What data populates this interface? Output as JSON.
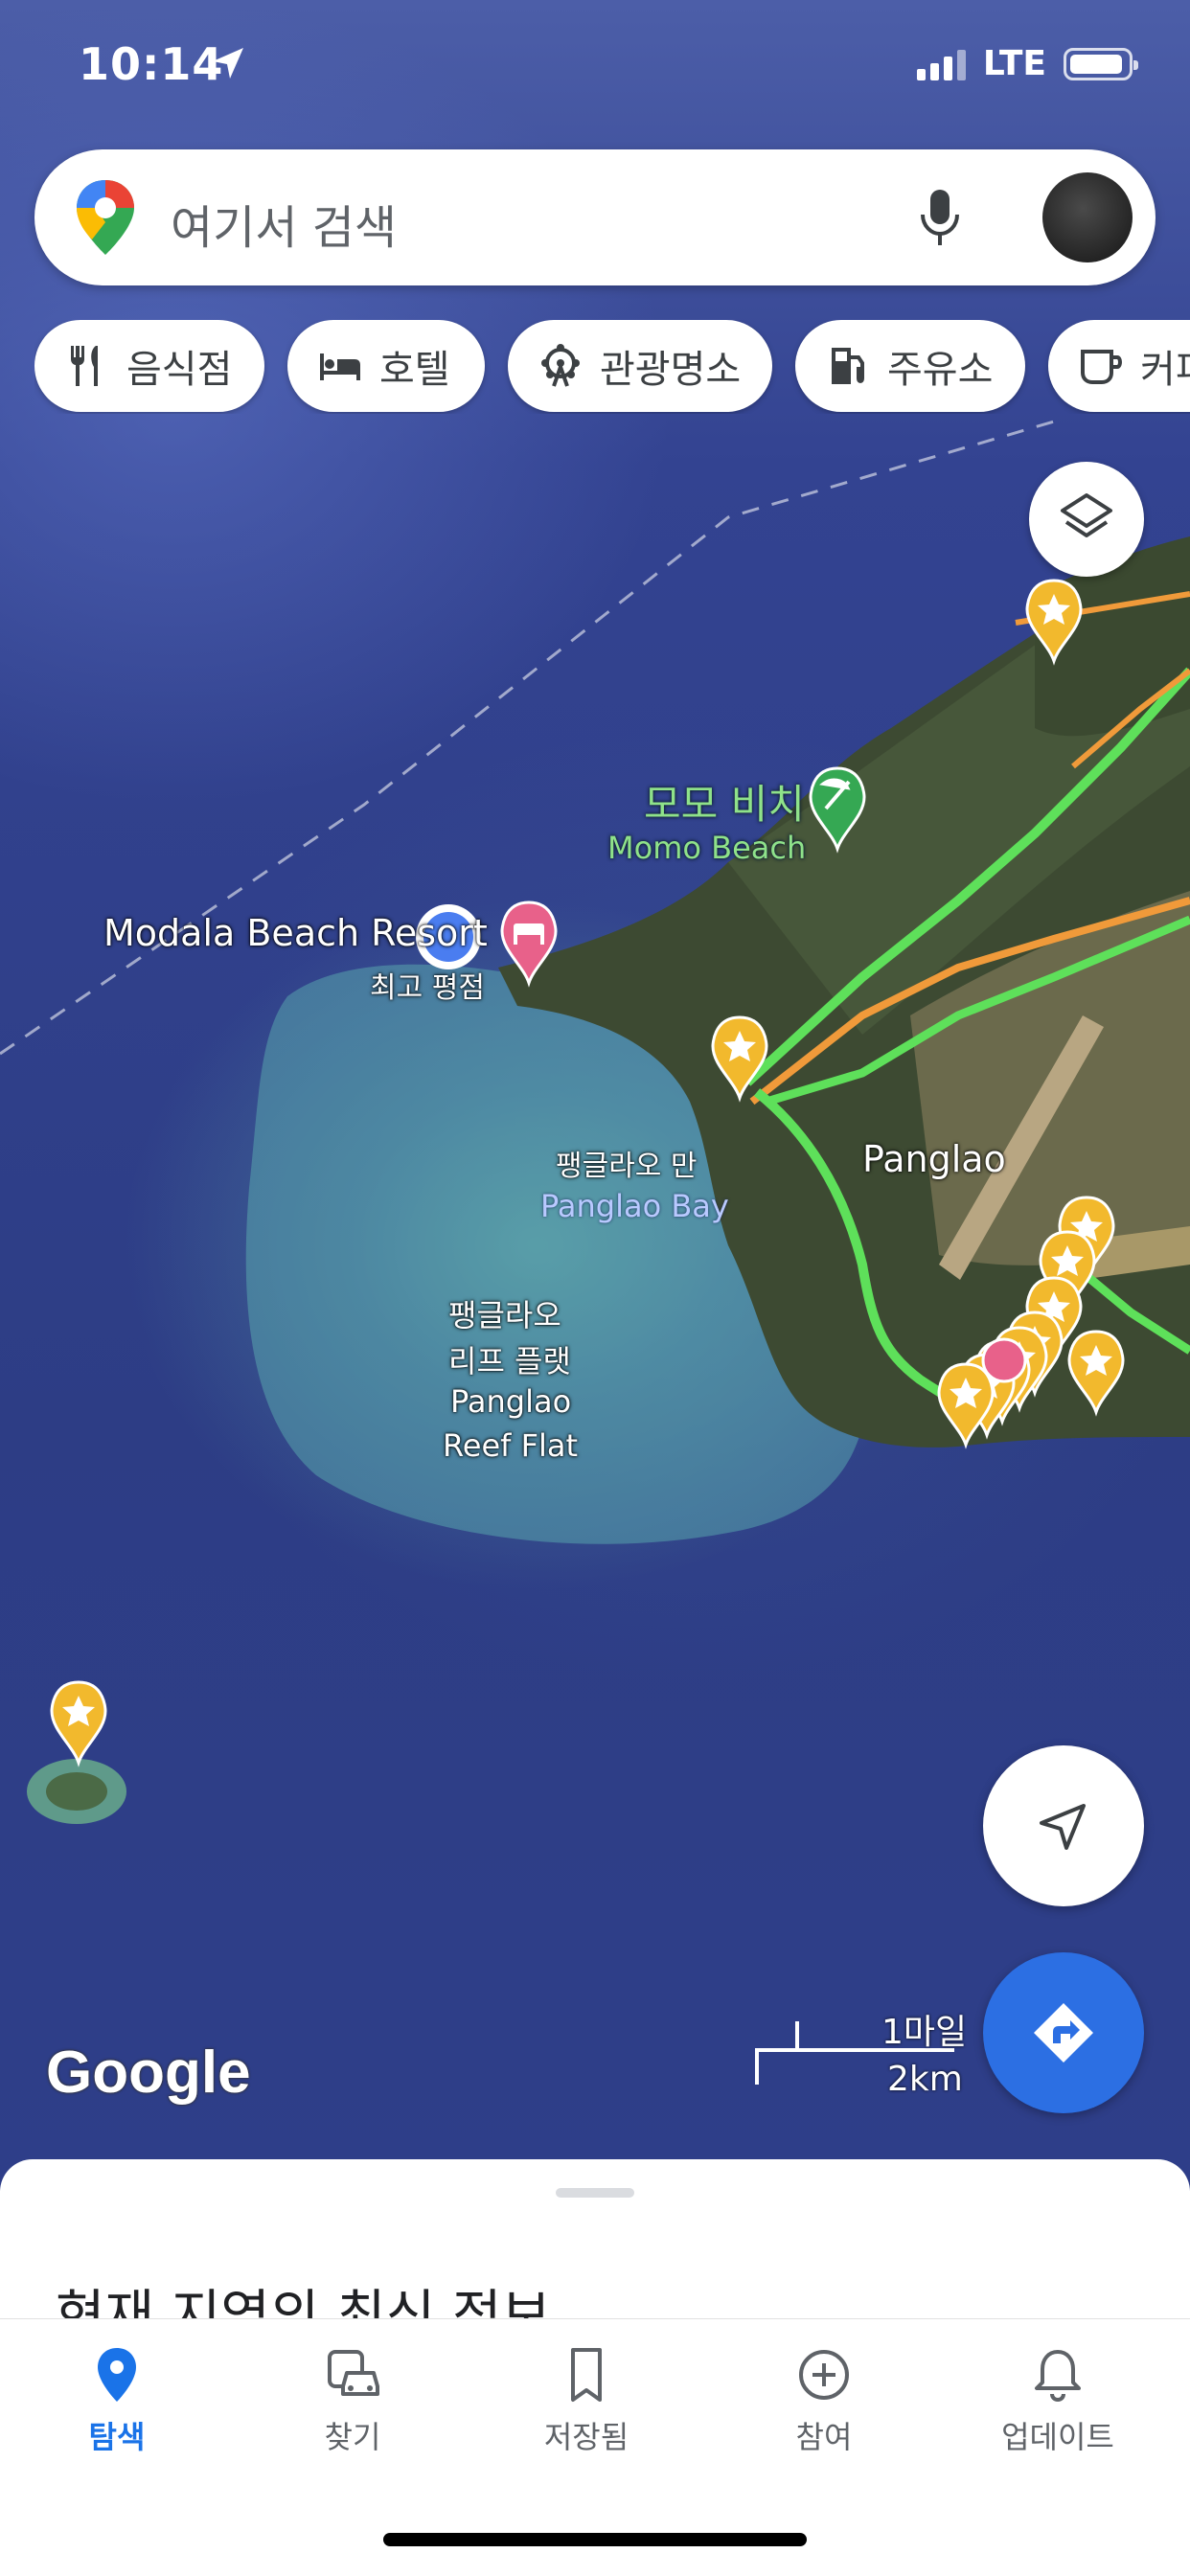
{
  "status_bar": {
    "time": "10:14",
    "network": "LTE",
    "location_icon": "location-arrow-icon"
  },
  "search": {
    "placeholder": "여기서 검색",
    "icons": [
      "google-maps-pin-icon",
      "mic-icon",
      "avatar"
    ]
  },
  "chips": [
    {
      "label": "음식점",
      "icon": "fork-knife-icon"
    },
    {
      "label": "호텔",
      "icon": "bed-icon"
    },
    {
      "label": "관광명소",
      "icon": "ferris-wheel-icon"
    },
    {
      "label": "주유소",
      "icon": "gas-pump-icon"
    },
    {
      "label": "커피",
      "icon": "coffee-cup-icon"
    }
  ],
  "map": {
    "labels": {
      "momo_ko": "모모 비치",
      "momo_en": "Momo Beach",
      "modala": "Modala Beach Resort",
      "modala_rating": "최고 평점",
      "bay_ko": "팽글라오 만",
      "bay_en": "Panglao Bay",
      "town": "Panglao",
      "reef_line1": "팽글라오",
      "reef_line2": "리프 플랫",
      "reef_line3": "Panglao",
      "reef_line4": "Reef Flat"
    },
    "brand": "Google",
    "scale_imperial": "1마일",
    "scale_metric": "2km",
    "colors": {
      "traffic_green": "#5ee05a",
      "traffic_orange": "#f09a3a",
      "my_location": "#4a7df0",
      "star_pin": "#f2b92d",
      "hotel_pin": "#e8618a",
      "beach_pin": "#35a853"
    }
  },
  "sheet": {
    "title": "현재 지역의 최신 정보"
  },
  "bottom_nav": [
    {
      "label": "탐색",
      "icon": "explore-pin-icon",
      "active": true
    },
    {
      "label": "찾기",
      "icon": "car-bus-icon",
      "active": false
    },
    {
      "label": "저장됨",
      "icon": "bookmark-icon",
      "active": false
    },
    {
      "label": "참여",
      "icon": "plus-circle-icon",
      "active": false
    },
    {
      "label": "업데이트",
      "icon": "bell-icon",
      "active": false
    }
  ]
}
